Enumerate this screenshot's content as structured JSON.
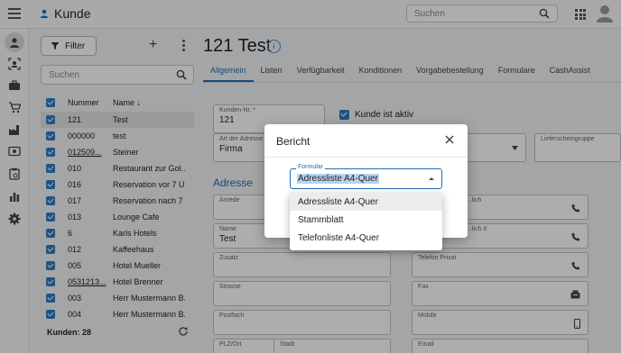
{
  "app": {
    "title": "Kunde",
    "search_placeholder": "Suchen"
  },
  "list": {
    "filter_label": "Filter",
    "search_placeholder": "Suchen",
    "columns": {
      "number": "Nummer",
      "name": "Name"
    },
    "rows": [
      {
        "number": "121",
        "name": "Test",
        "selected": true,
        "underline": false
      },
      {
        "number": "000000",
        "name": "test",
        "underline": false
      },
      {
        "number": "012509...",
        "name": "Steiner",
        "underline": true
      },
      {
        "number": "010",
        "name": "Restaurant zur Gol...",
        "underline": false
      },
      {
        "number": "016",
        "name": "Reservation vor 7 U...",
        "underline": false
      },
      {
        "number": "017",
        "name": "Reservation nach 7 ...",
        "underline": false
      },
      {
        "number": "013",
        "name": "Lounge Cafe",
        "underline": false
      },
      {
        "number": "6",
        "name": "Karls Hotels",
        "underline": false
      },
      {
        "number": "012",
        "name": "Kaffeehaus",
        "underline": false
      },
      {
        "number": "005",
        "name": "Hotel Mueller",
        "underline": false
      },
      {
        "number": "0531213...",
        "name": "Hotel Brenner",
        "underline": true
      },
      {
        "number": "003",
        "name": "Herr Mustermann B...",
        "underline": false
      },
      {
        "number": "004",
        "name": "Herr Mustermann B...",
        "underline": false
      }
    ],
    "footer": "Kunden: 28"
  },
  "detail": {
    "title": "121 Test",
    "tabs": [
      "Allgemein",
      "Listen",
      "Verfügbarkeit",
      "Konditionen",
      "Vorgabebestellung",
      "Formulare",
      "CashAssist"
    ],
    "active_tab": "Allgemein",
    "kunden_nr_label": "Kunden-Nr. *",
    "kunden_nr_value": "121",
    "aktiv_label": "Kunde ist aktiv",
    "adressart_label": "Art der Adresse",
    "adressart_value": "Firma",
    "lieferscheingruppe_label": "Lieferscheingruppe",
    "section_address": "Adresse",
    "anrede_label": "Anrede",
    "name_label": "Name",
    "name_value": "Test",
    "zusatz_label": "Zusatz",
    "strasse_label": "Strasse",
    "postfach_label": "Postfach",
    "plz_label": "PLZ/Ort",
    "stadt_label": "Stadt",
    "phone1_label": "...lich",
    "phone2_label": "...lich II",
    "telefon_privat_label": "Telefon Privat",
    "fax_label": "Fax",
    "mobile_label": "Mobile",
    "email_label": "Email"
  },
  "dialog": {
    "title": "Bericht",
    "field_label": "Formular",
    "field_value": "Adressliste A4-Quer",
    "options": [
      "Adressliste A4-Quer",
      "Stammblatt",
      "Telefonliste A4-Quer"
    ],
    "highlighted_option": "Adressliste A4-Quer"
  },
  "colors": {
    "accent": "#1f6fb7",
    "checkbox": "#2c7cc4"
  }
}
